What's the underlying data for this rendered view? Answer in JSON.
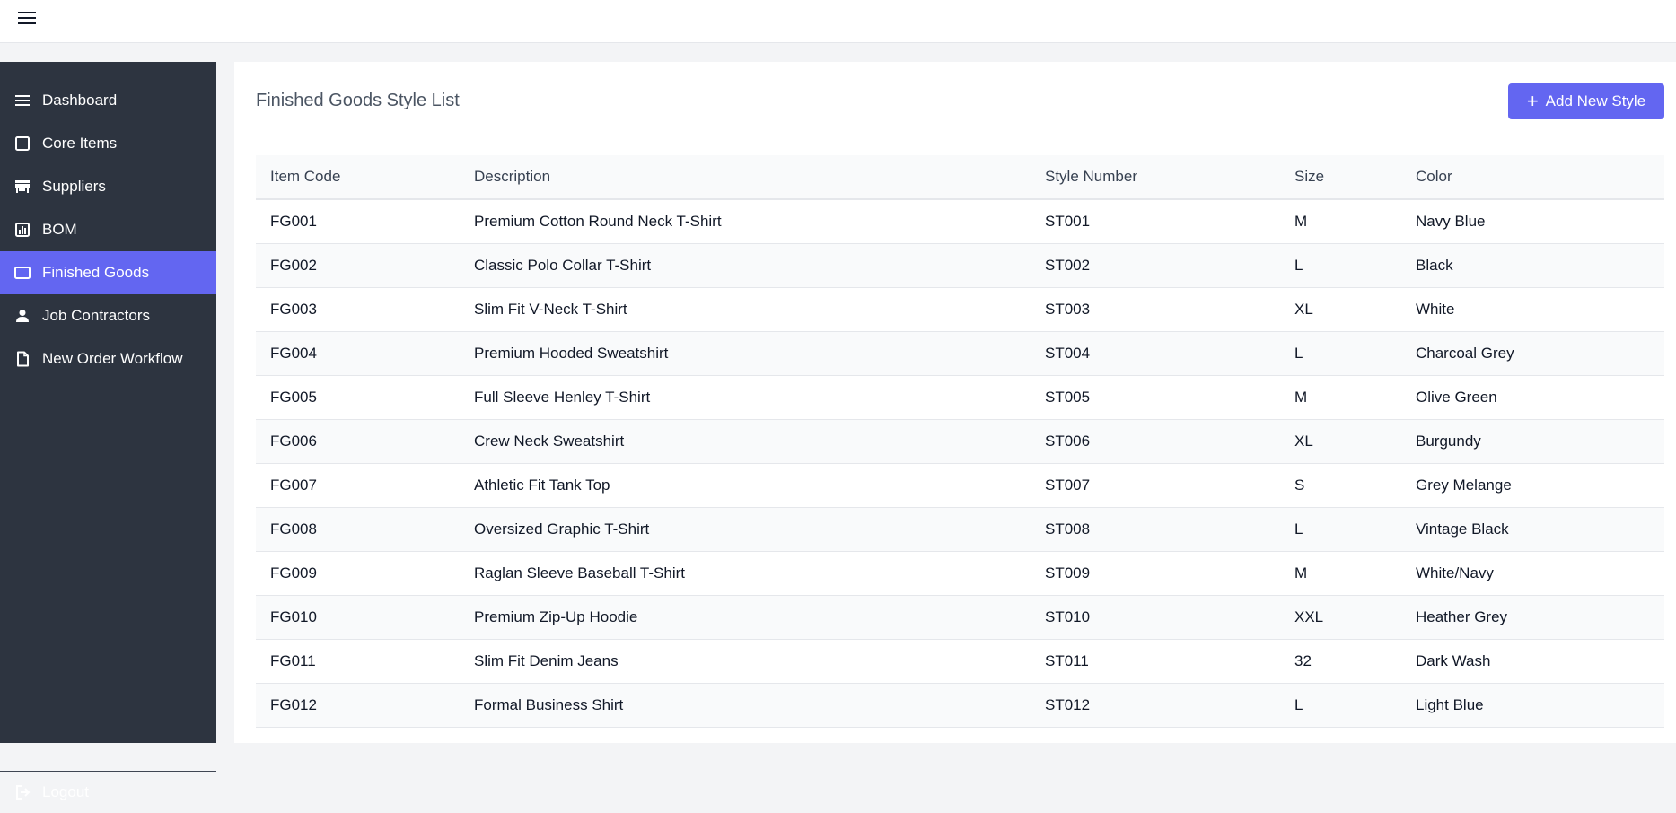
{
  "sidebar": {
    "items": [
      {
        "label": "Dashboard",
        "icon": "menu-lines-icon"
      },
      {
        "label": "Core Items",
        "icon": "square-icon"
      },
      {
        "label": "Suppliers",
        "icon": "store-icon"
      },
      {
        "label": "BOM",
        "icon": "chart-icon"
      },
      {
        "label": "Finished Goods",
        "icon": "rectangle-icon",
        "active": true
      },
      {
        "label": "Job Contractors",
        "icon": "user-icon"
      },
      {
        "label": "New Order Workflow",
        "icon": "document-icon"
      }
    ],
    "logout_label": "Logout"
  },
  "main": {
    "title": "Finished Goods Style List",
    "add_button_label": "Add New Style",
    "table": {
      "columns": [
        "Item Code",
        "Description",
        "Style Number",
        "Size",
        "Color"
      ],
      "rows": [
        [
          "FG001",
          "Premium Cotton Round Neck T-Shirt",
          "ST001",
          "M",
          "Navy Blue"
        ],
        [
          "FG002",
          "Classic Polo Collar T-Shirt",
          "ST002",
          "L",
          "Black"
        ],
        [
          "FG003",
          "Slim Fit V-Neck T-Shirt",
          "ST003",
          "XL",
          "White"
        ],
        [
          "FG004",
          "Premium Hooded Sweatshirt",
          "ST004",
          "L",
          "Charcoal Grey"
        ],
        [
          "FG005",
          "Full Sleeve Henley T-Shirt",
          "ST005",
          "M",
          "Olive Green"
        ],
        [
          "FG006",
          "Crew Neck Sweatshirt",
          "ST006",
          "XL",
          "Burgundy"
        ],
        [
          "FG007",
          "Athletic Fit Tank Top",
          "ST007",
          "S",
          "Grey Melange"
        ],
        [
          "FG008",
          "Oversized Graphic T-Shirt",
          "ST008",
          "L",
          "Vintage Black"
        ],
        [
          "FG009",
          "Raglan Sleeve Baseball T-Shirt",
          "ST009",
          "M",
          "White/Navy"
        ],
        [
          "FG010",
          "Premium Zip-Up Hoodie",
          "ST010",
          "XXL",
          "Heather Grey"
        ],
        [
          "FG011",
          "Slim Fit Denim Jeans",
          "ST011",
          "32",
          "Dark Wash"
        ],
        [
          "FG012",
          "Formal Business Shirt",
          "ST012",
          "L",
          "Light Blue"
        ]
      ]
    }
  },
  "colors": {
    "accent": "#6366f1",
    "sidebar_bg": "#2d3440"
  }
}
